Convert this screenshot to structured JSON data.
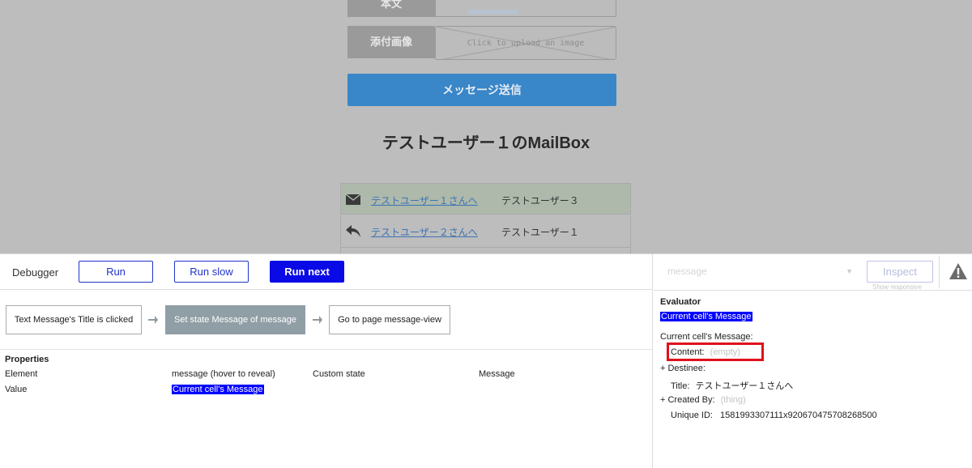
{
  "page": {
    "body_label": "本文",
    "attach_label": "添付画像",
    "upload_text": "Click to upload an image",
    "send_button": "メッセージ送信",
    "mailbox_title": "テストユーザー１のMailBox",
    "rows": [
      {
        "link": "テストユーザー１さんへ",
        "from": "テストユーザー３",
        "icon": "envelope-icon"
      },
      {
        "link": "テストユーザー２さんへ",
        "from": "テストユーザー１",
        "icon": "reply-icon"
      }
    ]
  },
  "debugger": {
    "title": "Debugger",
    "run": "Run",
    "run_slow": "Run slow",
    "run_next": "Run next",
    "steps": [
      "Text Message's Title is clicked",
      "Set state Message of message",
      "Go to page message-view"
    ],
    "properties": {
      "heading": "Properties",
      "element_label": "Element",
      "element_value": "message (hover to reveal)",
      "custom_state_label": "Custom state",
      "custom_state_value": "Message",
      "value_label": "Value",
      "value_value": "Current cell's Message"
    }
  },
  "inspector": {
    "element_placeholder": "message",
    "inspect_button": "Inspect",
    "show_responsive": "Show responsive",
    "evaluator_heading": "Evaluator",
    "evaluator_expression": "Current cell's Message",
    "object_label": "Current cell's Message:",
    "content_label": "Content:",
    "content_value": "(empty)",
    "destinee_label": "+ Destinee:",
    "title_label": "Title:",
    "title_value": "テストユーザー１さんへ",
    "created_by_label": "+ Created By:",
    "created_by_value": "(thing)",
    "unique_id_label": "Unique ID:",
    "unique_id_value": "1581993307111x920670475708268500"
  },
  "colors": {
    "accent_blue": "#0a0ae6",
    "button_border": "#2133c8",
    "send_button": "#3986c8",
    "highlight_red": "#e1101a",
    "active_step": "#909ea6"
  }
}
